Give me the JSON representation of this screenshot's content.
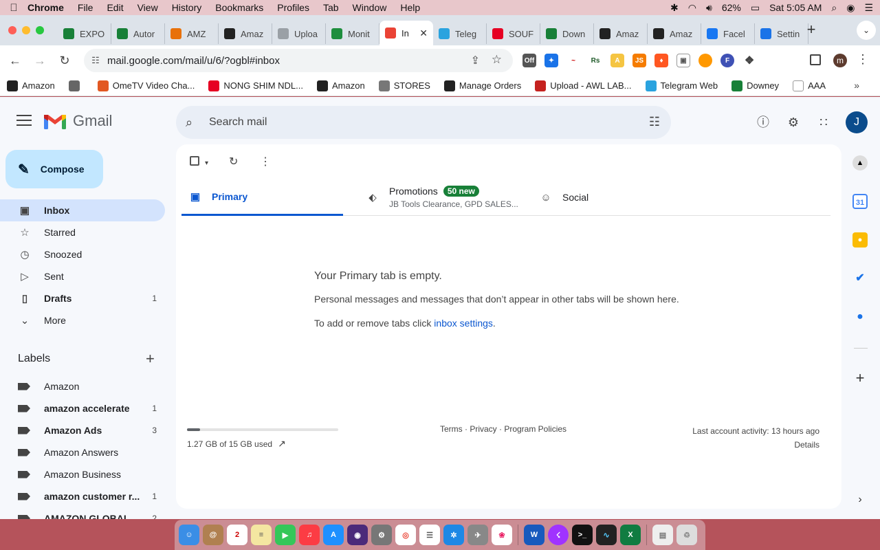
{
  "menubar": {
    "app_name": "Chrome",
    "items": [
      "File",
      "Edit",
      "View",
      "History",
      "Bookmarks",
      "Profiles",
      "Tab",
      "Window",
      "Help"
    ],
    "battery": "62%",
    "clock": "Sat 5:05 AM"
  },
  "tabs": [
    {
      "title": "EXPO",
      "icon": "sheets-icon",
      "color": "#188038"
    },
    {
      "title": "Autor",
      "icon": "sheets-icon",
      "color": "#188038"
    },
    {
      "title": "AMZ",
      "icon": "pen-icon",
      "color": "#e8710a"
    },
    {
      "title": "Amaz",
      "icon": "amazon-icon",
      "color": "#222222"
    },
    {
      "title": "Uploa",
      "icon": "loading-icon",
      "color": "#9aa0a6"
    },
    {
      "title": "Monit",
      "icon": "monitor-icon",
      "color": "#1e8e3e"
    },
    {
      "title": "In",
      "icon": "gmail-icon",
      "color": "#ea4335",
      "active": true
    },
    {
      "title": "Teleg",
      "icon": "telegram-icon",
      "color": "#2aa3df"
    },
    {
      "title": "SOUF",
      "icon": "pinterest-icon",
      "color": "#e60023"
    },
    {
      "title": "Down",
      "icon": "sheets-icon",
      "color": "#188038"
    },
    {
      "title": "Amaz",
      "icon": "amazon-icon",
      "color": "#222222"
    },
    {
      "title": "Amaz",
      "icon": "amazon-icon",
      "color": "#222222"
    },
    {
      "title": "Facel",
      "icon": "facebook-icon",
      "color": "#1877f2"
    },
    {
      "title": "Settin",
      "icon": "gear-icon",
      "color": "#1a73e8"
    }
  ],
  "toolbar": {
    "url": "mail.google.com/mail/u/6/?ogbl#inbox",
    "profile_initial": "m"
  },
  "bookmarks": [
    {
      "label": "Amazon",
      "icon": "amazon-icon",
      "color": "#222222"
    },
    {
      "label": "",
      "icon": "globe-icon",
      "color": "#666666"
    },
    {
      "label": "OmeTV Video Cha...",
      "icon": "tv-icon",
      "color": "#e25822"
    },
    {
      "label": "NONG SHIM NDL...",
      "icon": "pinterest-icon",
      "color": "#e60023"
    },
    {
      "label": "Amazon",
      "icon": "amazon-icon",
      "color": "#222222"
    },
    {
      "label": "STORES",
      "icon": "folder-icon",
      "color": "#777777"
    },
    {
      "label": "Manage Orders",
      "icon": "amazon-icon",
      "color": "#222222"
    },
    {
      "label": "Upload - AWL LAB...",
      "icon": "triangle-icon",
      "color": "#c5221f"
    },
    {
      "label": "Telegram Web",
      "icon": "telegram-icon",
      "color": "#2aa3df"
    },
    {
      "label": "Downey",
      "icon": "sheets-icon",
      "color": "#188038"
    },
    {
      "label": "AAA",
      "icon": "amazon-icon",
      "color": "#ffffff"
    }
  ],
  "gmail": {
    "brand": "Gmail",
    "search_placeholder": "Search mail",
    "avatar_initial": "J",
    "compose_label": "Compose",
    "nav": [
      {
        "label": "Inbox",
        "icon": "inbox-icon",
        "count": "",
        "active": true
      },
      {
        "label": "Starred",
        "icon": "star-icon",
        "count": ""
      },
      {
        "label": "Snoozed",
        "icon": "clock-icon",
        "count": ""
      },
      {
        "label": "Sent",
        "icon": "send-icon",
        "count": ""
      },
      {
        "label": "Drafts",
        "icon": "draft-icon",
        "count": "1",
        "bold": true
      },
      {
        "label": "More",
        "icon": "chevron-down-icon",
        "count": ""
      }
    ],
    "labels_heading": "Labels",
    "labels": [
      {
        "label": "Amazon",
        "count": "",
        "bold": false
      },
      {
        "label": "amazon accelerate",
        "count": "1",
        "bold": true
      },
      {
        "label": "Amazon Ads",
        "count": "3",
        "bold": true
      },
      {
        "label": "Amazon Answers",
        "count": "",
        "bold": false
      },
      {
        "label": "Amazon Business",
        "count": "",
        "bold": false
      },
      {
        "label": "amazon customer r...",
        "count": "1",
        "bold": true
      },
      {
        "label": "AMAZON GLOBAL",
        "count": "2",
        "bold": true
      }
    ],
    "category_tabs": {
      "primary": "Primary",
      "promotions": "Promotions",
      "promotions_badge": "50 new",
      "promotions_snippet": "JB Tools Clearance, GPD SALES...",
      "social": "Social"
    },
    "empty_state": {
      "title": "Your Primary tab is empty.",
      "body": "Personal messages and messages that don’t appear in other tabs will be shown here.",
      "settings_prefix": "To add or remove tabs click ",
      "settings_link": "inbox settings",
      "settings_suffix": "."
    },
    "footer": {
      "storage": "1.27 GB of 15 GB used",
      "storage_fraction": 0.085,
      "links": "Terms · Privacy · Program Policies",
      "last_activity": "Last account activity: 13 hours ago",
      "details": "Details"
    }
  },
  "colors": {
    "accent": "#0b57d0",
    "compose_bg": "#c2e7ff",
    "active_nav": "#d3e3fd",
    "badge": "#188038"
  }
}
